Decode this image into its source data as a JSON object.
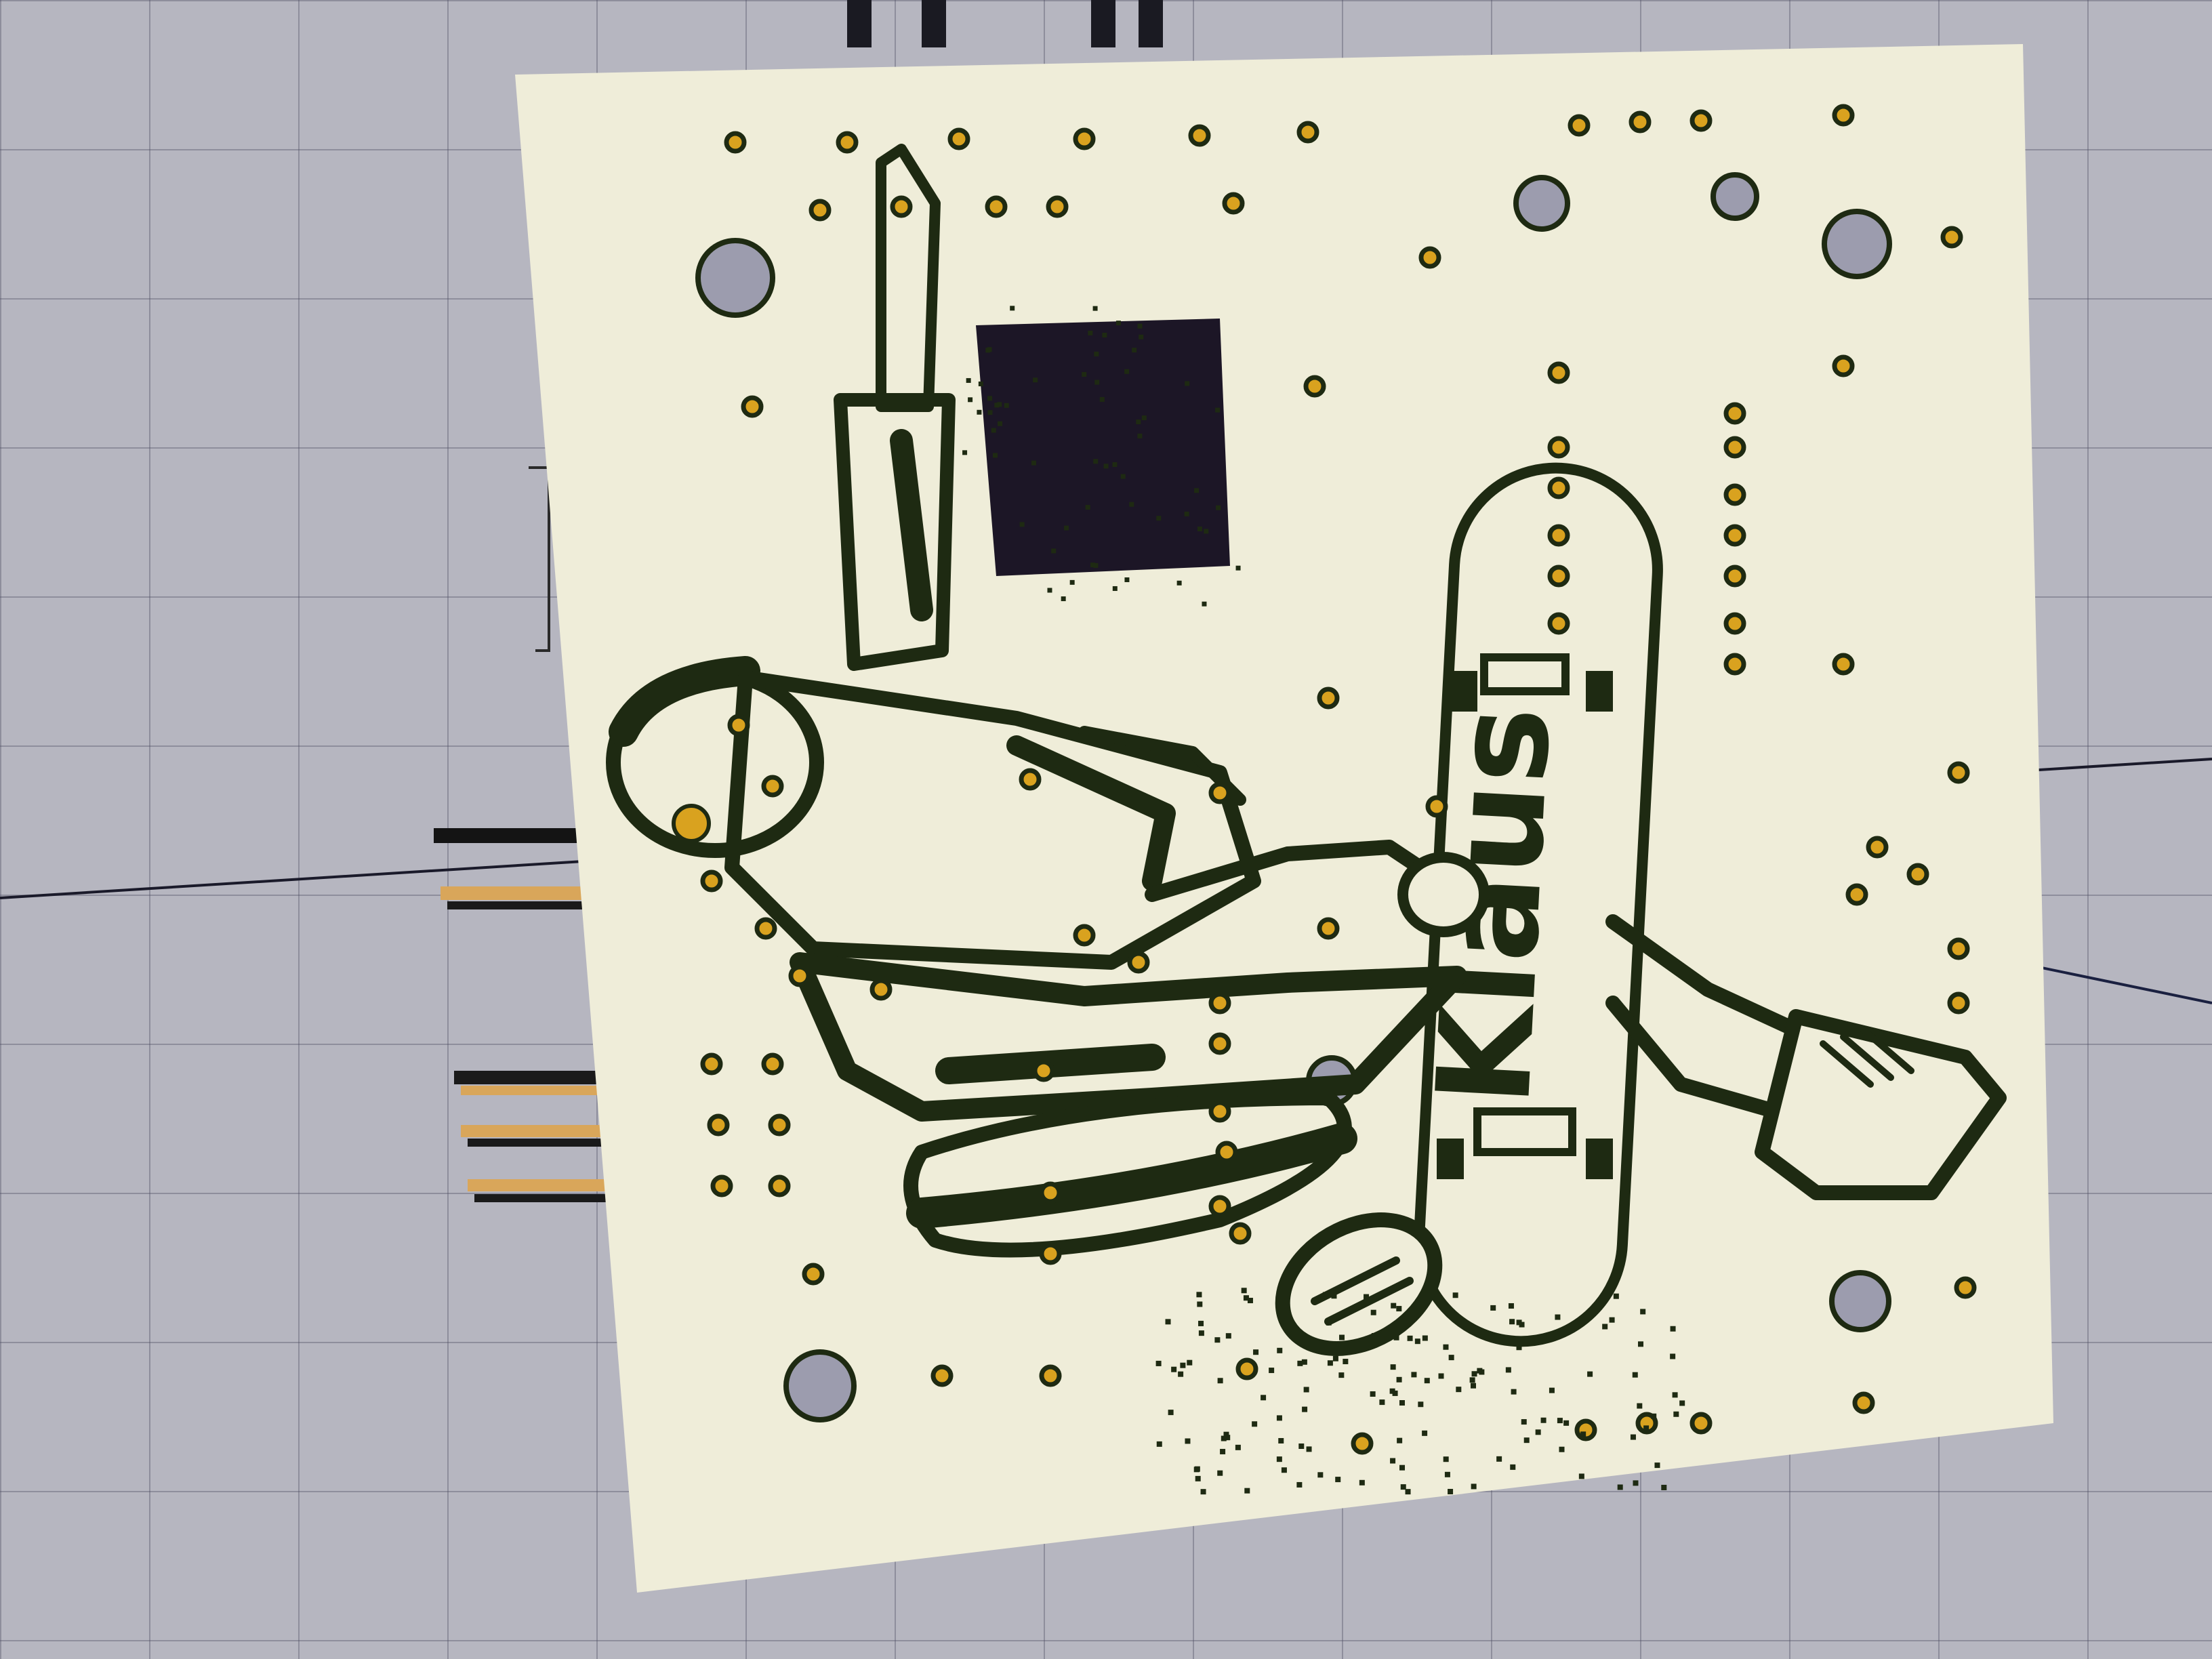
{
  "viewer": {
    "background_color": "#b6b6c0",
    "grid_color": "#5a5a72"
  },
  "board": {
    "substrate_color": "#efedd9",
    "silkscreen_color": "#1e2a12",
    "pad_color": "#d9a21f",
    "cutout_color": "#1c1626",
    "hole_color": "#9c9cae",
    "deck_text": "Klaus",
    "artwork": "skateboarder-falling"
  }
}
